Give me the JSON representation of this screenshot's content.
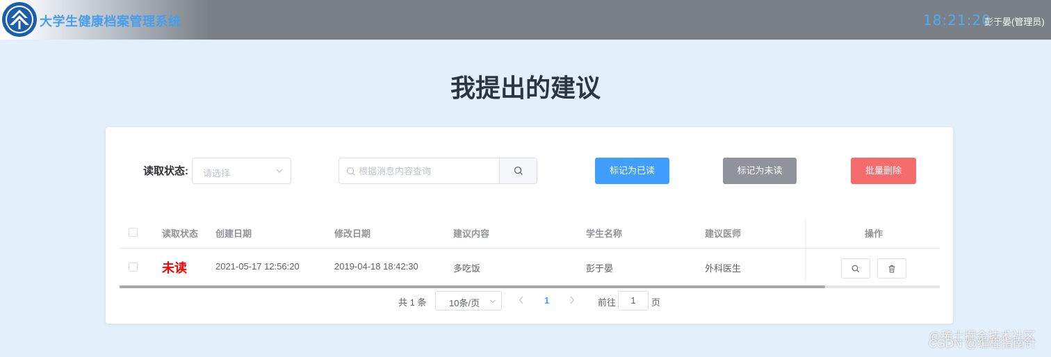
{
  "header": {
    "system_title": "大学生健康档案管理系统",
    "clock": "18:21:20",
    "user": "彭于晏(管理员)"
  },
  "page": {
    "title": "我提出的建议"
  },
  "filters": {
    "status_label": "读取状态:",
    "status_placeholder": "请选择",
    "search_placeholder": "根据消息内容查询",
    "search_value": ""
  },
  "actions": {
    "mark_read": "标记为已读",
    "mark_unread": "标记为未读",
    "batch_delete": "批量删除"
  },
  "table": {
    "columns": [
      "读取状态",
      "创建日期",
      "修改日期",
      "建议内容",
      "学生名称",
      "建议医师",
      "操作"
    ],
    "rows": [
      {
        "status": "未读",
        "created": "2021-05-17 12:56:20",
        "modified": "2019-04-18 18:42:30",
        "content": "多吃饭",
        "student": "彭于晏",
        "doctor": "外科医生"
      }
    ],
    "horizontal_scroll_fraction": 0.86
  },
  "pagination": {
    "total": "共 1 条",
    "page_size": "10条/页",
    "current_page": "1",
    "goto_label": "前往",
    "goto_value": "1",
    "page_suffix": "页"
  },
  "watermark": {
    "line1": "@稀土掘金技术社区",
    "line2": "CSDN @编程指南针"
  },
  "colors": {
    "primary": "#409eff",
    "info": "#909399",
    "danger": "#f56c6c",
    "unread": "#ff0000",
    "background": "#e3f0fc"
  },
  "icons": [
    "university-logo-icon",
    "chevron-down-icon",
    "search-icon",
    "trash-icon",
    "chevron-left-icon",
    "chevron-right-icon"
  ]
}
